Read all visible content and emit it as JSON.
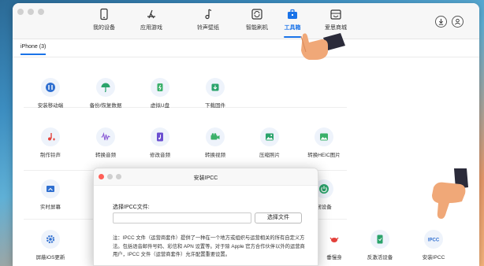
{
  "nav": {
    "items": [
      {
        "label": "我的设备",
        "icon": "phone-icon"
      },
      {
        "label": "应用游戏",
        "icon": "app-store-icon"
      },
      {
        "label": "铃声壁纸",
        "icon": "music-note-icon"
      },
      {
        "label": "智能刷机",
        "icon": "refresh-icon"
      },
      {
        "label": "工具箱",
        "icon": "toolbox-icon"
      },
      {
        "label": "爱思商城",
        "icon": "store-icon"
      }
    ],
    "active_index": 4
  },
  "subtabs": [
    {
      "label": "iPhone (3)"
    }
  ],
  "tools": [
    {
      "label": "安装移动端",
      "icon": "mobile-install-icon"
    },
    {
      "label": "备份/恢复数据",
      "icon": "umbrella-icon"
    },
    {
      "label": "虚拟U盘",
      "icon": "usb-drive-icon"
    },
    {
      "label": "下载固件",
      "icon": "download-icon"
    },
    {
      "label": "制作铃声",
      "icon": "ringtone-icon"
    },
    {
      "label": "转换音频",
      "icon": "audio-wave-icon"
    },
    {
      "label": "修改音频",
      "icon": "audio-file-icon"
    },
    {
      "label": "转换视频",
      "icon": "video-icon"
    },
    {
      "label": "压缩照片",
      "icon": "photo-icon"
    },
    {
      "label": "转换HEIC图片",
      "icon": "heic-icon"
    },
    {
      "label": "实时屏幕",
      "icon": "screen-icon"
    },
    {
      "label": "闭设备",
      "icon": "power-icon"
    },
    {
      "label": "屏蔽iOS更新",
      "icon": "gear-icon"
    },
    {
      "label": "垂慢身",
      "icon": "crab-icon"
    },
    {
      "label": "反激活设备",
      "icon": "deactivate-icon"
    },
    {
      "label": "安装IPCC",
      "icon": "ipcc-icon"
    }
  ],
  "dialog": {
    "title": "安装IPCC",
    "file_label": "选择IPCC文件:",
    "file_value": "",
    "choose_button": "选择文件",
    "note": "注：IPCC 文件（运营商套件）提供了一种在一个地方或组织与运营相关的所有自定义方法。包括语音邮件号码、彩信和 APN 设置等。对于除 Apple 官方合作伙伴以外的运营商用户，IPCC 文件（运营商套件）允许配置重要设置。"
  },
  "colors": {
    "accent": "#1a73e8",
    "hand": "#f0a878"
  }
}
